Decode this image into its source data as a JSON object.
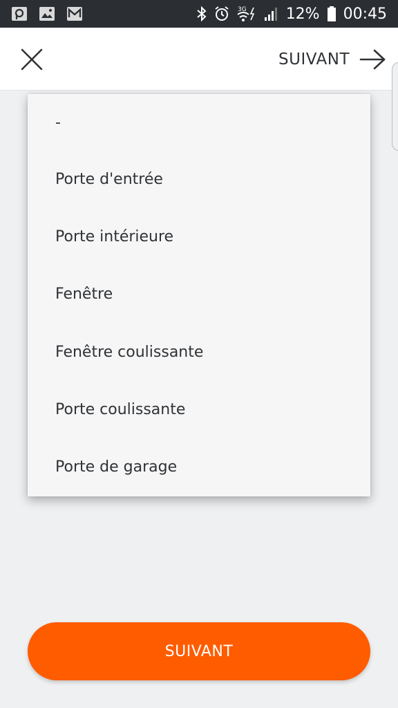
{
  "status_bar": {
    "left_icons": [
      "parking-app-icon",
      "gallery-icon",
      "gmail-icon"
    ],
    "right_icons": [
      "bluetooth-icon",
      "alarm-icon",
      "wifi-3g-icon",
      "signal-icon"
    ],
    "battery": "12%",
    "time": "00:45"
  },
  "header": {
    "close_icon": "close-icon",
    "next_label": "SUIVANT",
    "next_icon": "arrow-right-icon"
  },
  "dropdown": {
    "options": [
      "-",
      "Porte d'entrée",
      "Porte intérieure",
      "Fenêtre",
      "Fenêtre coulissante",
      "Porte coulissante",
      "Porte de garage"
    ]
  },
  "footer": {
    "primary_label": "SUIVANT",
    "primary_color": "#ff5c00"
  }
}
